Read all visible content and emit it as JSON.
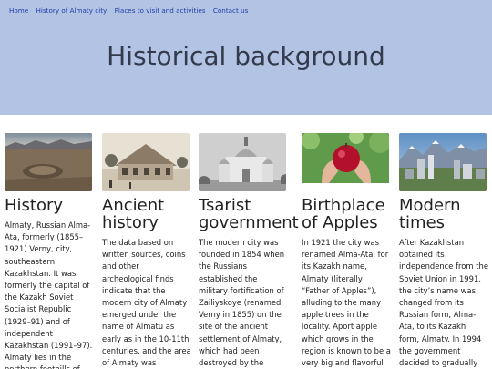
{
  "nav": [
    "Home",
    "History of Almaty city",
    "Places to visit and activities",
    "Contact us"
  ],
  "hero": {
    "title": "Historical background"
  },
  "cards": [
    {
      "image": "steppe-crater-landscape",
      "title": "History",
      "text": "Almaty, Russian Alma-Ata, formerly (1855–1921) Verny, city, southeastern Kazakhstan. It was formerly the capital of the Kazakh Soviet Socialist Republic (1929–91) and of independent Kazakhstan (1991–97). Almaty lies in the northern foothills of"
    },
    {
      "image": "old-city-building-photo",
      "title": "Ancient history",
      "text": "The data based on written sources, coins and other archeological finds indicate that the modern city of Almaty emerged under the name of Almatu as early as in the 10-11th centuries, and the area of Almaty was inhabited by"
    },
    {
      "image": "orthodox-cathedral-photo",
      "title": "Tsarist government",
      "text": "The modern city was founded in 1854 when the Russians established the military fortification of Zailiyskoye (renamed Verny in 1855) on the site of the ancient settlement of Almaty, which had been destroyed by the"
    },
    {
      "image": "apple-in-hands-photo",
      "title": "Birthplace of Apples",
      "text": "In 1921 the city was renamed Alma-Ata, for its Kazakh name, Almaty (literally “Father of Apples”), alluding to the many apple trees in the locality. Aport apple which grows in the region is known to be a very big and flavorful variety of"
    },
    {
      "image": "modern-city-skyline-photo",
      "title": "Modern times",
      "text": "After Kazakhstan obtained its independence from the Soviet Union in 1991, the city’s name was changed from its Russian form, Alma-Ata, to its Kazakh form, Almaty. In 1994 the government decided to gradually"
    }
  ]
}
